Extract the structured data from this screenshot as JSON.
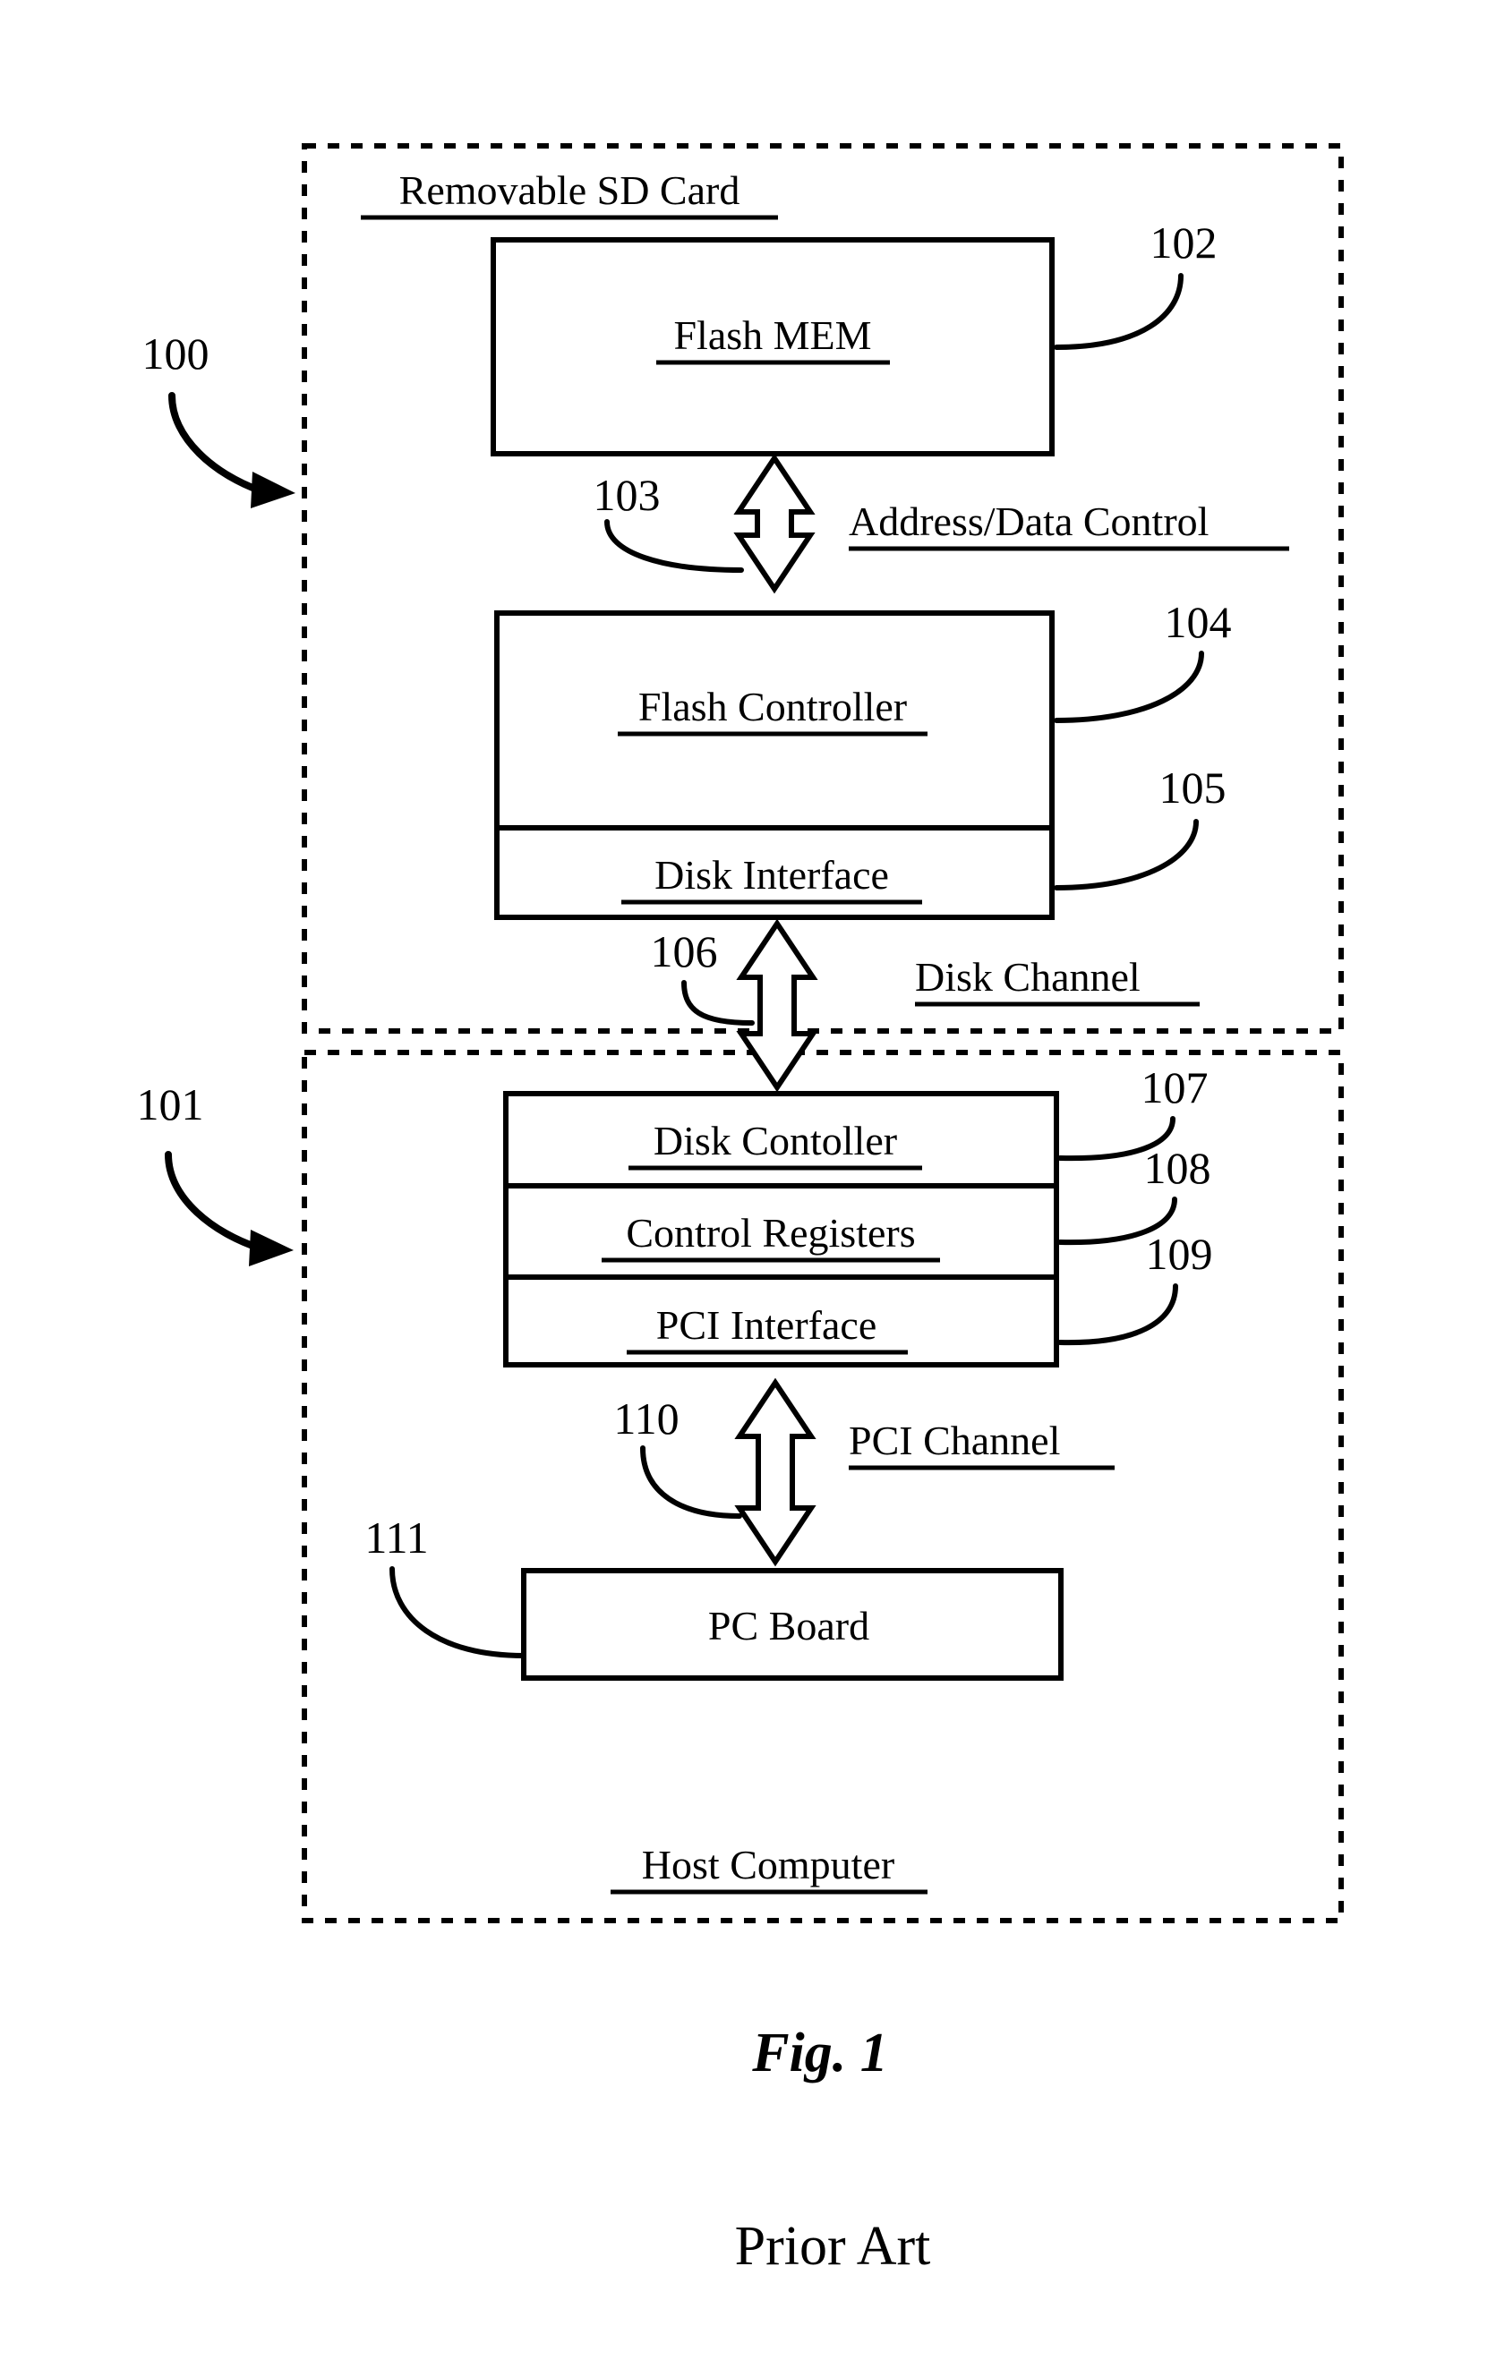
{
  "figure": {
    "caption": "Fig. 1",
    "status_note": "Prior Art"
  },
  "containers": [
    {
      "id": "removable-sd-card",
      "label": "Removable SD Card",
      "ref": "100"
    },
    {
      "id": "host-computer",
      "label": "Host Computer",
      "ref": "101"
    }
  ],
  "blocks": [
    {
      "id": "flash-mem",
      "label": "Flash MEM",
      "ref": "102",
      "underlined": true
    },
    {
      "id": "flash-controller",
      "label": "Flash Controller",
      "ref": "104",
      "underlined": true
    },
    {
      "id": "disk-interface",
      "label": "Disk Interface",
      "ref": "105",
      "underlined": true
    },
    {
      "id": "disk-controller",
      "label": "Disk Contoller",
      "ref": "107",
      "underlined": true
    },
    {
      "id": "control-registers",
      "label": "Control Registers",
      "ref": "108",
      "underlined": true
    },
    {
      "id": "pci-interface",
      "label": "PCI Interface",
      "ref": "109",
      "underlined": true
    },
    {
      "id": "pc-board",
      "label": "PC Board",
      "ref": "111",
      "underlined": false
    }
  ],
  "channels": [
    {
      "id": "address-data-control",
      "label": "Address/Data Control",
      "ref": "103"
    },
    {
      "id": "disk-channel",
      "label": "Disk Channel",
      "ref": "106"
    },
    {
      "id": "pci-channel",
      "label": "PCI Channel",
      "ref": "110"
    }
  ],
  "colors": {
    "ink": "#000000",
    "paper": "#ffffff"
  }
}
